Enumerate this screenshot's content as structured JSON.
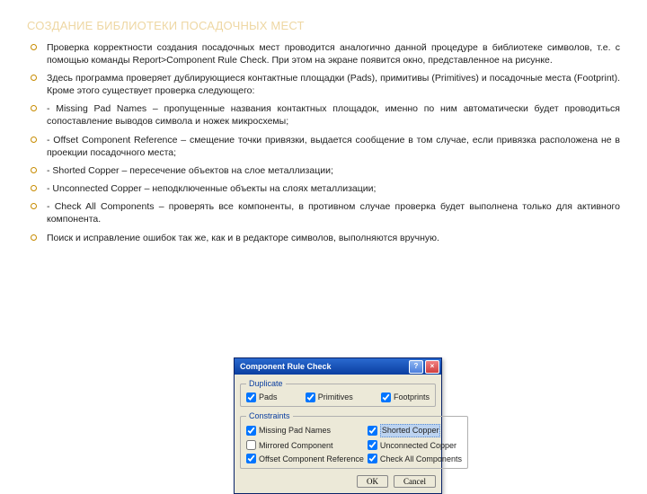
{
  "title": "СОЗДАНИЕ БИБЛИОТЕКИ ПОСАДОЧНЫХ МЕСТ",
  "bullets": [
    "Проверка корректности создания посадочных мест проводится аналогично данной процедуре в библиотеке символов, т.е. с помощью команды Report>Component Rule Check. При этом на экране появится окно, представленное на рисунке.",
    "Здесь программа проверяет дублирующиеся контактные площадки (Pads), примитивы (Primitives) и посадочные места (Footprint). Кроме этого существует проверка следующего:",
    " - Missing Pad Names – пропущенные названия контактных площадок, именно по ним автоматически будет проводиться сопоставление выводов символа и ножек микросхемы;",
    " - Offset Component Reference – смещение точки привязки, выдается сообщение в том случае, если привязка расположена не в проекции посадочного места;",
    " - Shorted Copper – пересечение объектов на слое металлизации;",
    " - Unconnected Copper – неподключенные объекты на слоях металлизации;",
    " - Check All Components – проверять все  компоненты, в противном случае проверка будет выполнена только для активного компонента.",
    "Поиск и исправление ошибок так же, как и в редакторе символов, выполняются вручную."
  ],
  "dialog": {
    "title": "Component Rule Check",
    "help": "?",
    "close": "×",
    "groups": {
      "duplicate": {
        "legend": "Duplicate",
        "pads": "Pads",
        "primitives": "Primitives",
        "footprints": "Footprints"
      },
      "constraints": {
        "legend": "Constraints",
        "missing": "Missing Pad Names",
        "shorted": "Shorted Copper",
        "mirrored": "Mirrored Component",
        "unconnected": "Unconnected Copper",
        "offset": "Offset Component Reference",
        "checkall": "Check All Components"
      }
    },
    "ok": "OK",
    "cancel": "Cancel"
  }
}
